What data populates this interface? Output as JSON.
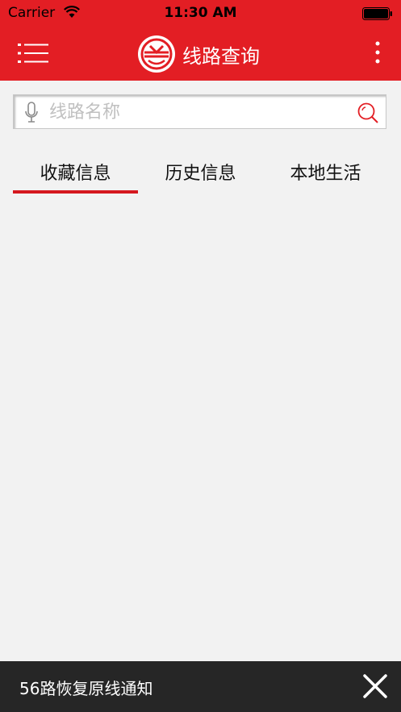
{
  "status_bar": {
    "carrier": "Carrier",
    "time": "11:30 AM",
    "icons": [
      "wifi-icon",
      "battery-icon"
    ]
  },
  "nav": {
    "title": "线路查询",
    "icons": [
      "menu-icon",
      "logo",
      "more-vertical-icon"
    ],
    "accent_color": "#e31e24"
  },
  "search": {
    "placeholder": "线路名称",
    "value": "",
    "icons": [
      "microphone-icon",
      "search-icon"
    ],
    "search_icon_color": "#e31e24"
  },
  "tabs": [
    {
      "label": "收藏信息",
      "selected": true
    },
    {
      "label": "历史信息",
      "selected": false
    },
    {
      "label": "本地生活",
      "selected": false
    }
  ],
  "notice": {
    "text": "56路恢复原线通知",
    "icon": "close-icon",
    "background": "#262626"
  }
}
